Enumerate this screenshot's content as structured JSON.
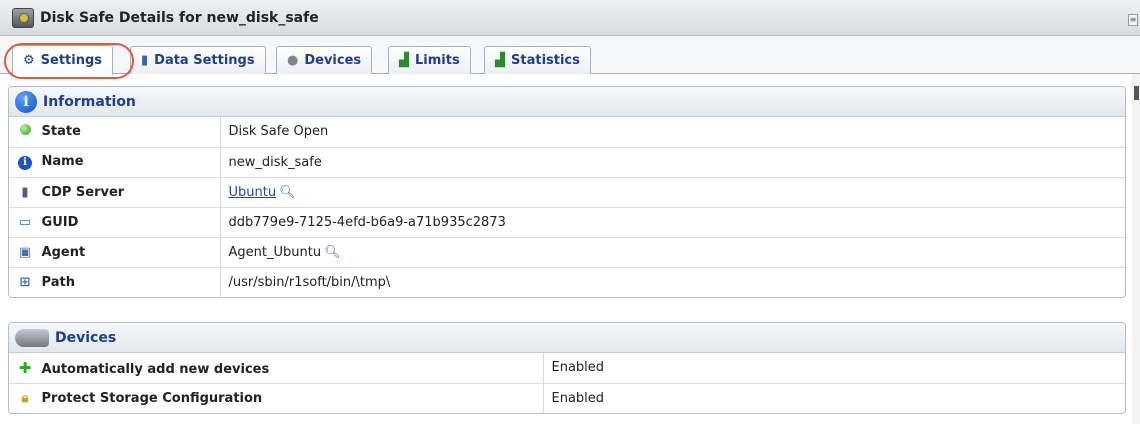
{
  "window": {
    "title": "Disk Safe Details for new_disk_safe",
    "icon": "disk-safe-icon"
  },
  "tabs": [
    {
      "label": "Settings",
      "icon": "gear-icon",
      "active": true
    },
    {
      "label": "Data Settings",
      "icon": "database-icon",
      "active": false
    },
    {
      "label": "Devices",
      "icon": "drive-icon",
      "active": false
    },
    {
      "label": "Limits",
      "icon": "chart-icon",
      "active": false
    },
    {
      "label": "Statistics",
      "icon": "chart-icon",
      "active": false
    }
  ],
  "information": {
    "header": "Information",
    "rows": [
      {
        "label": "State",
        "value": "Disk Safe Open",
        "icon": "green-status-dot-icon"
      },
      {
        "label": "Name",
        "value": "new_disk_safe",
        "icon": "info-icon"
      },
      {
        "label": "CDP Server",
        "value": "Ubuntu",
        "icon": "server-icon",
        "link": true
      },
      {
        "label": "GUID",
        "value": "ddb779e9-7125-4efd-b6a9-a71b935c2873",
        "icon": "id-card-icon"
      },
      {
        "label": "Agent",
        "value": "Agent_Ubuntu",
        "icon": "computer-icon"
      },
      {
        "label": "Path",
        "value": "/usr/sbin/r1soft/bin/\\tmp\\",
        "icon": "path-icon"
      }
    ]
  },
  "devices": {
    "header": "Devices",
    "rows": [
      {
        "label": "Automatically add new devices",
        "value": "Enabled",
        "icon": "green-plus-icon"
      },
      {
        "label": "Protect Storage Configuration",
        "value": "Enabled",
        "icon": "lock-icon"
      }
    ]
  },
  "colors": {
    "tab_text": "#1f3f8c",
    "highlight": "#e05a3a",
    "link": "#1a4fa3"
  }
}
